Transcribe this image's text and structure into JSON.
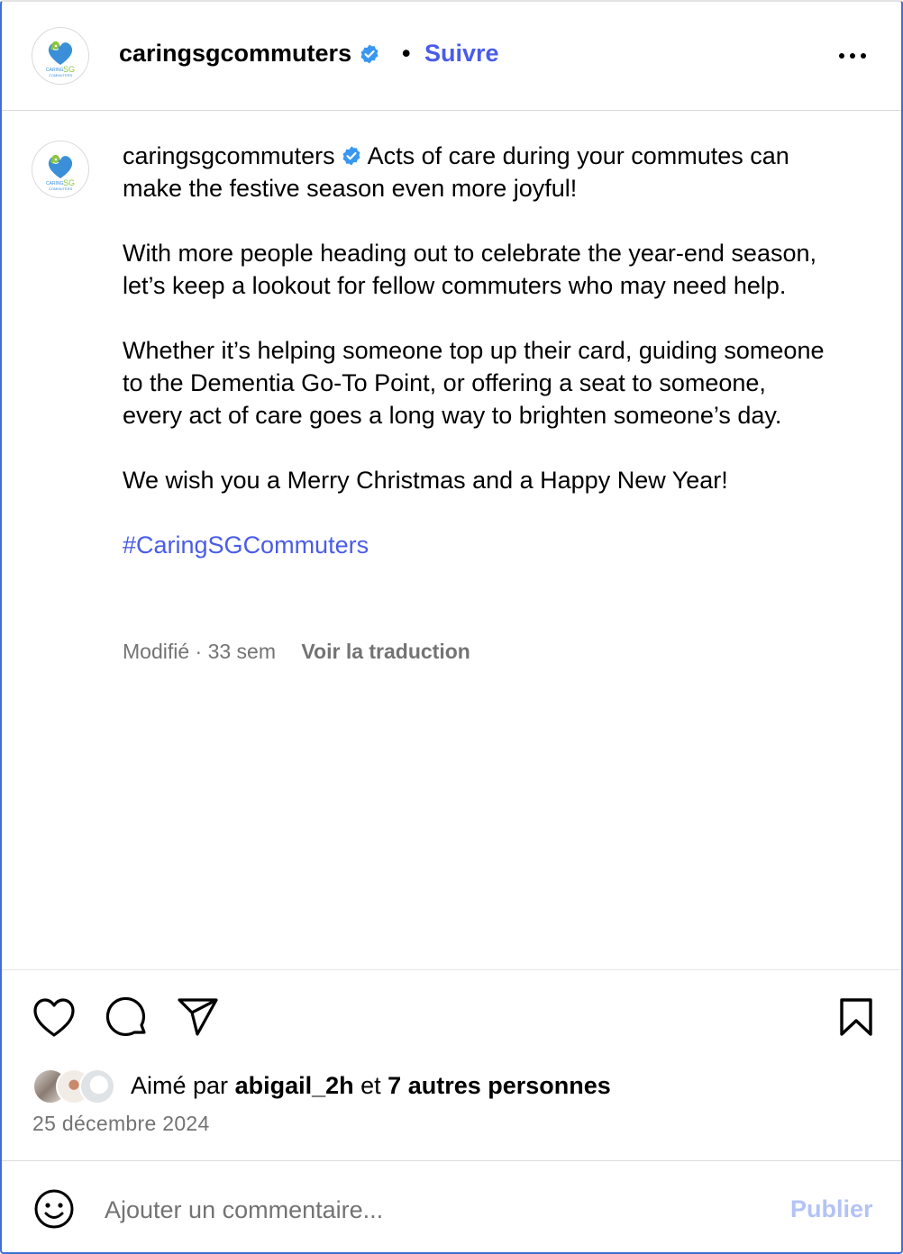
{
  "header": {
    "username": "caringsgcommuters",
    "separator": "•",
    "follow_label": "Suivre",
    "more_icon": "more-horizontal-icon",
    "logo_text": "CARING SG COMMUTERS"
  },
  "caption": {
    "username": "caringsgcommuters",
    "paragraphs": [
      "Acts of care during your commutes can make the festive season even more joyful!",
      "With more people heading out to celebrate the year-end season, let’s keep a lookout for fellow commuters who may need help.",
      "Whether it’s helping someone top up their card, guiding someone to the Dementia Go-To Point, or offering a seat to someone, every act of care goes a long way to brighten someone’s day.",
      "We wish you a Merry Christmas and a Happy New Year!"
    ],
    "hashtag": "#CaringSGCommuters",
    "edited": "Modifié · 33 sem",
    "translate_label": "Voir la traduction"
  },
  "actions": {
    "like_icon": "heart-icon",
    "comment_icon": "comment-icon",
    "share_icon": "send-icon",
    "save_icon": "bookmark-icon"
  },
  "likes": {
    "prefix": "Aimé par",
    "first_user": "abigail_2h",
    "connector": "et",
    "others": "7 autres personnes"
  },
  "date": "25 décembre 2024",
  "comment": {
    "placeholder": "Ajouter un commentaire...",
    "publish_label": "Publier",
    "emoji_icon": "smiley-icon"
  },
  "colors": {
    "accent": "#4a5ce6",
    "verified": "#3897f0",
    "muted": "#737373",
    "publish_disabled": "#b3c3f5"
  }
}
